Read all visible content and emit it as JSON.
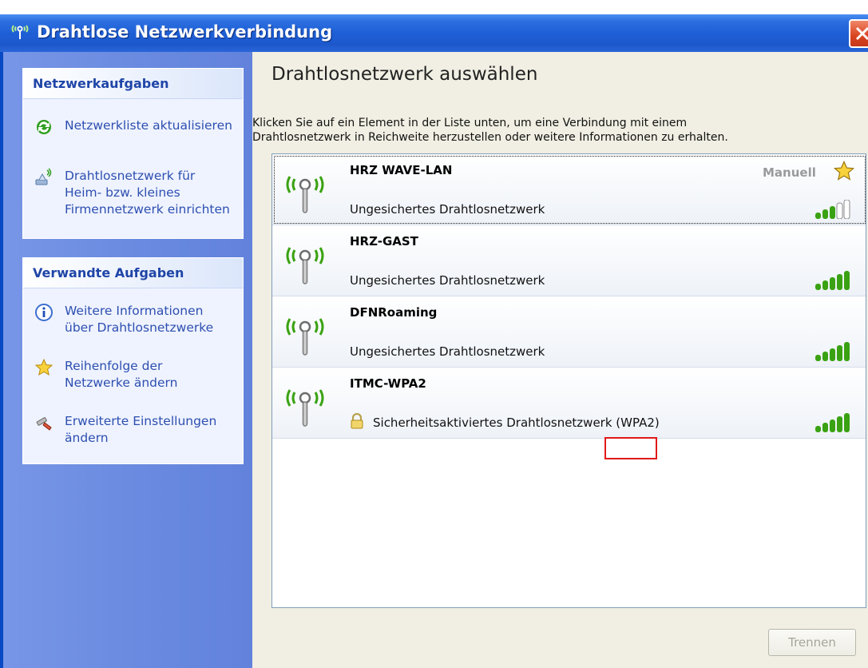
{
  "window": {
    "title": "Drahtlose Netzwerkverbindung"
  },
  "sidebar": {
    "network_tasks": {
      "header": "Netzwerkaufgaben",
      "items": [
        {
          "label": "Netzwerkliste aktualisieren",
          "icon": "refresh-icon"
        },
        {
          "label": "Drahtlosnetzwerk für\nHeim- bzw. kleines\nFirmennetzwerk einrichten",
          "icon": "wireless-setup-icon"
        }
      ]
    },
    "related_tasks": {
      "header": "Verwandte Aufgaben",
      "items": [
        {
          "label": "Weitere Informationen\nüber Drahtlosnetzwerke",
          "icon": "info-icon"
        },
        {
          "label": "Reihenfolge der\nNetzwerke ändern",
          "icon": "star-icon"
        },
        {
          "label": "Erweiterte Einstellungen\nändern",
          "icon": "settings-icon"
        }
      ]
    }
  },
  "main": {
    "heading": "Drahtlosnetzwerk auswählen",
    "instruction": "Klicken Sie auf ein Element in der Liste unten, um eine Verbindung mit einem\nDrahtlosnetzwerk in Reichweite herzustellen oder weitere Informationen zu erhalten.",
    "networks": [
      {
        "name": "HRZ WAVE-LAN",
        "description": "Ungesichertes Drahtlosnetzwerk",
        "status": "Manuell",
        "signal_bars": 3,
        "selected": true
      },
      {
        "name": "HRZ-GAST",
        "description": "Ungesichertes Drahtlosnetzwerk",
        "signal_bars": 5
      },
      {
        "name": "DFNRoaming",
        "description": "Ungesichertes Drahtlosnetzwerk",
        "signal_bars": 5
      },
      {
        "name": "ITMC-WPA2",
        "description": "Sicherheitsaktiviertes Drahtlosnetzwerk (WPA2)",
        "signal_bars": 5,
        "secured": true
      }
    ],
    "disconnect_button": "Trennen"
  },
  "colors": {
    "titlebar": "#1e5fd6",
    "sidebar": "#6a8be0",
    "panel_header_text": "#1f45a7",
    "task_link": "#2d4fb0",
    "signal_green": "#3aa212",
    "highlight": "#e01818"
  }
}
